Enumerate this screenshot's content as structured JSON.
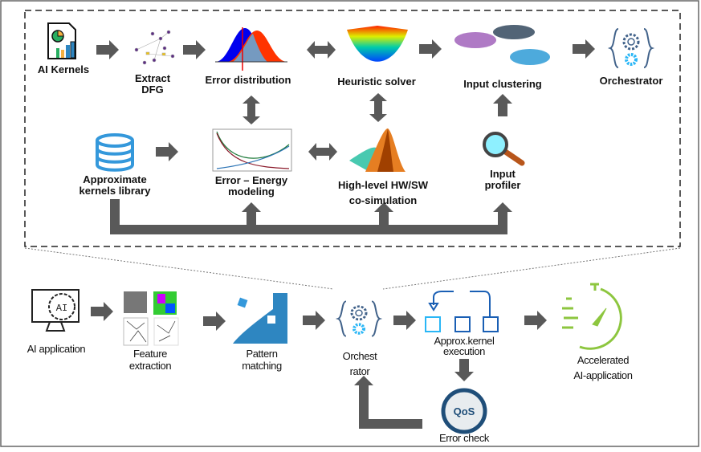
{
  "top_workflow": {
    "ai_kernels": "AI Kernels",
    "extract_dfg": [
      "Extract",
      "DFG"
    ],
    "error_distribution": "Error distribution",
    "heuristic_solver": "Heuristic solver",
    "input_clustering": "Input clustering",
    "orchestrator": "Orchestrator",
    "approx_library": [
      "Approximate",
      "kernels library"
    ],
    "error_energy": [
      "Error – Energy",
      "modeling"
    ],
    "cosim": [
      "High-level HW/SW",
      "co-simulation"
    ],
    "input_profiler": [
      "Input",
      "profiler"
    ]
  },
  "bottom_workflow": {
    "ai_application": "AI application",
    "ai_icon_text": "AI",
    "feature_extraction": [
      "Feature",
      "extraction"
    ],
    "pattern_matching": [
      "Pattern",
      "matching"
    ],
    "orchestrator": [
      "Orchest",
      "rator"
    ],
    "approx_exec": [
      "Approx.kernel",
      "execution"
    ],
    "qos": "QoS",
    "error_check": "Error check",
    "accelerated": [
      "Accelerated",
      "AI-application"
    ]
  },
  "colors": {
    "arrow": "#595959",
    "accent_blue": "#2e75b6",
    "green": "#8dc63f",
    "qos_ring": "#1f4e79"
  }
}
